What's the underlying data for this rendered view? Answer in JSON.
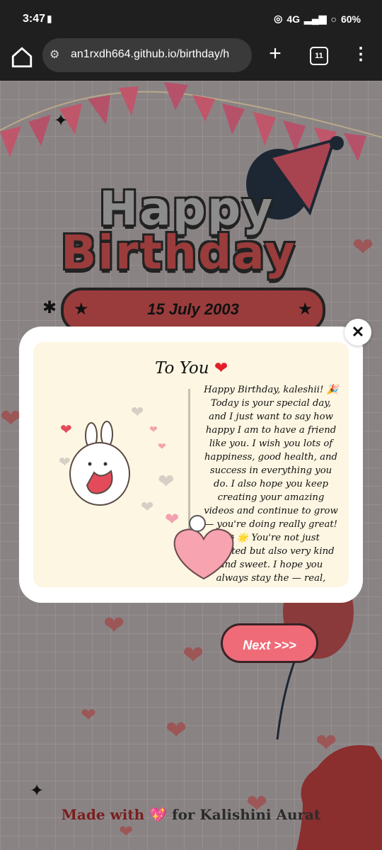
{
  "status_bar": {
    "time": "3:47",
    "network": "4G",
    "battery": "60%"
  },
  "browser": {
    "url": "an1rxdh664.github.io/birthday/h",
    "tab_count": "11"
  },
  "page": {
    "title_line1": "Happy",
    "title_line2": "Birthday",
    "date": "15 July 2003",
    "footer_prefix": "Made with",
    "footer_heart": "💖",
    "footer_suffix": "for Kalishini Aurat"
  },
  "modal": {
    "close_label": "✕",
    "card_title": "To You",
    "card_title_heart": "❤",
    "letter": "Happy Birthday, kaleshii! 🎉 Today is your special day, and I just want to say how happy I am to have a friend like you. I wish you lots of happiness, good health, and success in everything you do. I also hope you keep creating your amazing videos and continue to grow — you're doing really great! 📸 🌟 You're not just talented but also very kind and sweet. I hope you always stay the — real, simple, and just the way you are 😊 – Your friend, Shobhit"
  },
  "next_button": {
    "label": "Next >>>"
  },
  "colors": {
    "accent": "#f06b78",
    "title_red": "#9a3c3c",
    "card_bg": "#fdf6e2"
  }
}
